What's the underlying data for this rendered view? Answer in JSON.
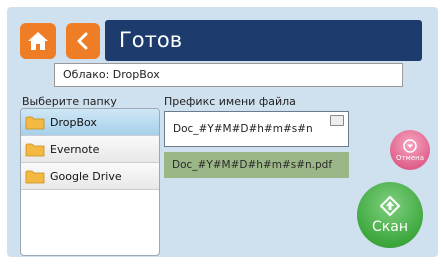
{
  "header": {
    "title": "Готов",
    "home_icon": "home-icon",
    "back_icon": "chevron-left-icon",
    "accent_color": "#ee7d25",
    "titlebar_color": "#1d3c6d"
  },
  "cloud": {
    "value": "Облако: DropBox"
  },
  "folders": {
    "label": "Выберите папку",
    "items": [
      {
        "label": "DropBox",
        "selected": true
      },
      {
        "label": "Evernote",
        "selected": false
      },
      {
        "label": "Google Drive",
        "selected": false
      }
    ]
  },
  "prefix": {
    "label": "Префикс имени файла",
    "value": "Doc_#Y#M#D#h#m#s#n",
    "preview": "Doc_#Y#M#D#h#m#s#n.pdf"
  },
  "buttons": {
    "cancel_label": "Отмена",
    "scan_label": "Скан",
    "cancel_color": "#e0628c",
    "scan_color": "#3ea83e"
  }
}
